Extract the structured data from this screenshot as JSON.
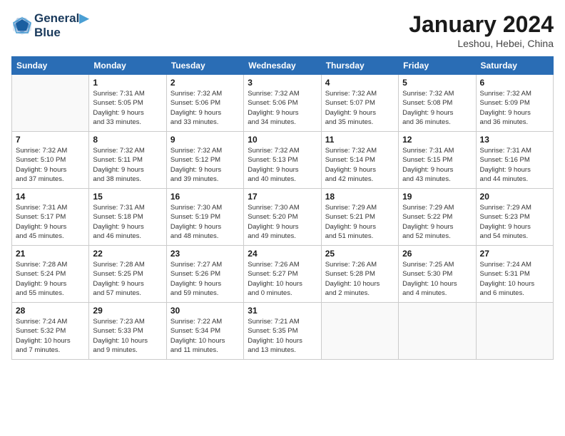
{
  "header": {
    "logo_line1": "General",
    "logo_line2": "Blue",
    "month_title": "January 2024",
    "location": "Leshou, Hebei, China"
  },
  "weekdays": [
    "Sunday",
    "Monday",
    "Tuesday",
    "Wednesday",
    "Thursday",
    "Friday",
    "Saturday"
  ],
  "weeks": [
    [
      {
        "day": "",
        "info": ""
      },
      {
        "day": "1",
        "info": "Sunrise: 7:31 AM\nSunset: 5:05 PM\nDaylight: 9 hours\nand 33 minutes."
      },
      {
        "day": "2",
        "info": "Sunrise: 7:32 AM\nSunset: 5:06 PM\nDaylight: 9 hours\nand 33 minutes."
      },
      {
        "day": "3",
        "info": "Sunrise: 7:32 AM\nSunset: 5:06 PM\nDaylight: 9 hours\nand 34 minutes."
      },
      {
        "day": "4",
        "info": "Sunrise: 7:32 AM\nSunset: 5:07 PM\nDaylight: 9 hours\nand 35 minutes."
      },
      {
        "day": "5",
        "info": "Sunrise: 7:32 AM\nSunset: 5:08 PM\nDaylight: 9 hours\nand 36 minutes."
      },
      {
        "day": "6",
        "info": "Sunrise: 7:32 AM\nSunset: 5:09 PM\nDaylight: 9 hours\nand 36 minutes."
      }
    ],
    [
      {
        "day": "7",
        "info": "Sunrise: 7:32 AM\nSunset: 5:10 PM\nDaylight: 9 hours\nand 37 minutes."
      },
      {
        "day": "8",
        "info": "Sunrise: 7:32 AM\nSunset: 5:11 PM\nDaylight: 9 hours\nand 38 minutes."
      },
      {
        "day": "9",
        "info": "Sunrise: 7:32 AM\nSunset: 5:12 PM\nDaylight: 9 hours\nand 39 minutes."
      },
      {
        "day": "10",
        "info": "Sunrise: 7:32 AM\nSunset: 5:13 PM\nDaylight: 9 hours\nand 40 minutes."
      },
      {
        "day": "11",
        "info": "Sunrise: 7:32 AM\nSunset: 5:14 PM\nDaylight: 9 hours\nand 42 minutes."
      },
      {
        "day": "12",
        "info": "Sunrise: 7:31 AM\nSunset: 5:15 PM\nDaylight: 9 hours\nand 43 minutes."
      },
      {
        "day": "13",
        "info": "Sunrise: 7:31 AM\nSunset: 5:16 PM\nDaylight: 9 hours\nand 44 minutes."
      }
    ],
    [
      {
        "day": "14",
        "info": "Sunrise: 7:31 AM\nSunset: 5:17 PM\nDaylight: 9 hours\nand 45 minutes."
      },
      {
        "day": "15",
        "info": "Sunrise: 7:31 AM\nSunset: 5:18 PM\nDaylight: 9 hours\nand 46 minutes."
      },
      {
        "day": "16",
        "info": "Sunrise: 7:30 AM\nSunset: 5:19 PM\nDaylight: 9 hours\nand 48 minutes."
      },
      {
        "day": "17",
        "info": "Sunrise: 7:30 AM\nSunset: 5:20 PM\nDaylight: 9 hours\nand 49 minutes."
      },
      {
        "day": "18",
        "info": "Sunrise: 7:29 AM\nSunset: 5:21 PM\nDaylight: 9 hours\nand 51 minutes."
      },
      {
        "day": "19",
        "info": "Sunrise: 7:29 AM\nSunset: 5:22 PM\nDaylight: 9 hours\nand 52 minutes."
      },
      {
        "day": "20",
        "info": "Sunrise: 7:29 AM\nSunset: 5:23 PM\nDaylight: 9 hours\nand 54 minutes."
      }
    ],
    [
      {
        "day": "21",
        "info": "Sunrise: 7:28 AM\nSunset: 5:24 PM\nDaylight: 9 hours\nand 55 minutes."
      },
      {
        "day": "22",
        "info": "Sunrise: 7:28 AM\nSunset: 5:25 PM\nDaylight: 9 hours\nand 57 minutes."
      },
      {
        "day": "23",
        "info": "Sunrise: 7:27 AM\nSunset: 5:26 PM\nDaylight: 9 hours\nand 59 minutes."
      },
      {
        "day": "24",
        "info": "Sunrise: 7:26 AM\nSunset: 5:27 PM\nDaylight: 10 hours\nand 0 minutes."
      },
      {
        "day": "25",
        "info": "Sunrise: 7:26 AM\nSunset: 5:28 PM\nDaylight: 10 hours\nand 2 minutes."
      },
      {
        "day": "26",
        "info": "Sunrise: 7:25 AM\nSunset: 5:30 PM\nDaylight: 10 hours\nand 4 minutes."
      },
      {
        "day": "27",
        "info": "Sunrise: 7:24 AM\nSunset: 5:31 PM\nDaylight: 10 hours\nand 6 minutes."
      }
    ],
    [
      {
        "day": "28",
        "info": "Sunrise: 7:24 AM\nSunset: 5:32 PM\nDaylight: 10 hours\nand 7 minutes."
      },
      {
        "day": "29",
        "info": "Sunrise: 7:23 AM\nSunset: 5:33 PM\nDaylight: 10 hours\nand 9 minutes."
      },
      {
        "day": "30",
        "info": "Sunrise: 7:22 AM\nSunset: 5:34 PM\nDaylight: 10 hours\nand 11 minutes."
      },
      {
        "day": "31",
        "info": "Sunrise: 7:21 AM\nSunset: 5:35 PM\nDaylight: 10 hours\nand 13 minutes."
      },
      {
        "day": "",
        "info": ""
      },
      {
        "day": "",
        "info": ""
      },
      {
        "day": "",
        "info": ""
      }
    ]
  ]
}
